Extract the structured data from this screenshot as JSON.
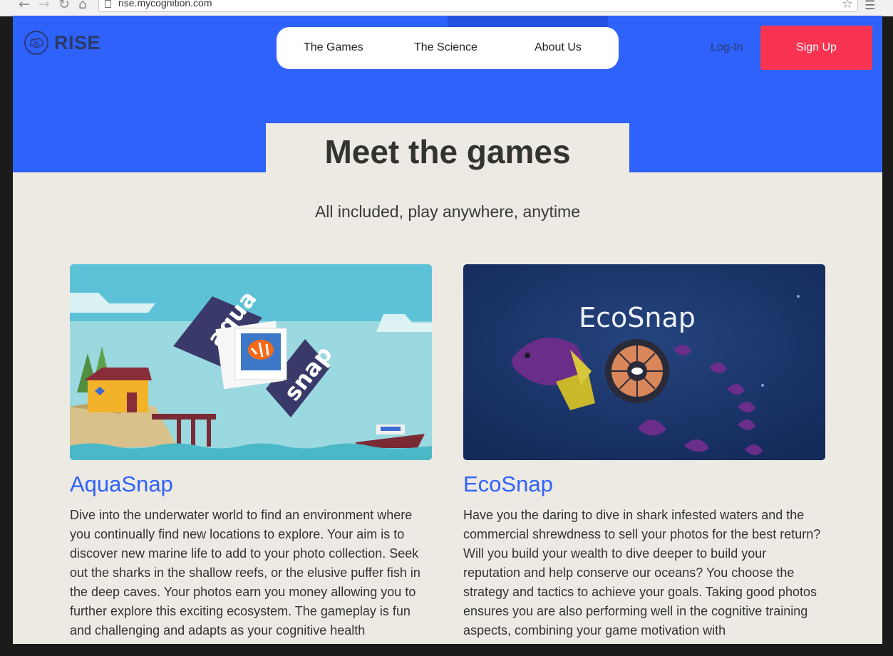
{
  "browser": {
    "url": "rise.mycognition.com"
  },
  "header": {
    "logo_text": "RISE",
    "nav": [
      "The Games",
      "The Science",
      "About Us"
    ],
    "login_label": "Log-In",
    "signup_label": "Sign Up"
  },
  "hero": {
    "title": "Meet the games",
    "subtitle": "All included, play anywhere, anytime"
  },
  "games": [
    {
      "name": "AquaSnap",
      "image_words": [
        "aqua",
        "snap"
      ],
      "description": "Dive into the underwater world to find an environment where you continually find new locations to explore. Your aim is to discover new marine life to add to your photo collection. Seek out the sharks in the shallow reefs, or the elusive puffer fish in the deep caves. Your photos earn you money allowing you to further explore this exciting ecosystem. The gameplay is fun and challenging and adapts as your cognitive health"
    },
    {
      "name": "EcoSnap",
      "image_title": "EcoSnap",
      "description": "Have you the daring to dive in shark infested waters and the commercial shrewdness to sell your photos for the best return? Will you build your wealth to dive deeper to build your reputation and help conserve our oceans? You choose the strategy and tactics to achieve your goals. Taking good photos ensures you are also performing well in the cognitive training aspects, combining your game motivation with"
    }
  ],
  "colors": {
    "hero_blue": "#2f62fb",
    "signup_red": "#f83452",
    "page_bg": "#edeae3"
  }
}
